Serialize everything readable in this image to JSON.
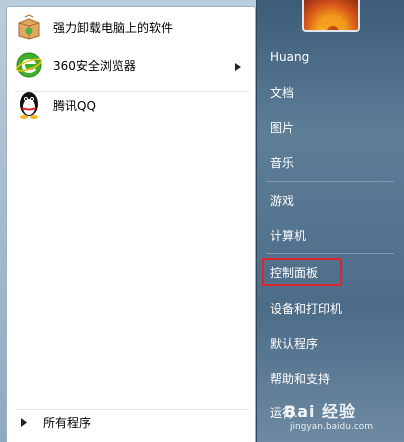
{
  "programs": [
    {
      "label": "强力卸载电脑上的软件",
      "icon": "uninstall-box-icon"
    },
    {
      "label": "360安全浏览器",
      "icon": "360-browser-icon",
      "has_submenu": true
    },
    {
      "label": "腾讯QQ",
      "icon": "qq-penguin-icon"
    }
  ],
  "all_programs_label": "所有程序",
  "right_items": [
    {
      "label": "Huang"
    },
    {
      "label": "文档"
    },
    {
      "label": "图片"
    },
    {
      "label": "音乐"
    },
    {
      "label": "游戏"
    },
    {
      "label": "计算机"
    },
    {
      "label": "控制面板",
      "highlighted": true
    },
    {
      "label": "设备和打印机"
    },
    {
      "label": "默认程序"
    },
    {
      "label": "帮助和支持"
    },
    {
      "label": "运行..."
    }
  ],
  "watermark": {
    "brand": "Bai 经验",
    "url": "jingyan.baidu.com"
  },
  "colors": {
    "highlight_box": "#e0242c",
    "right_pane": "#4c6c88"
  }
}
